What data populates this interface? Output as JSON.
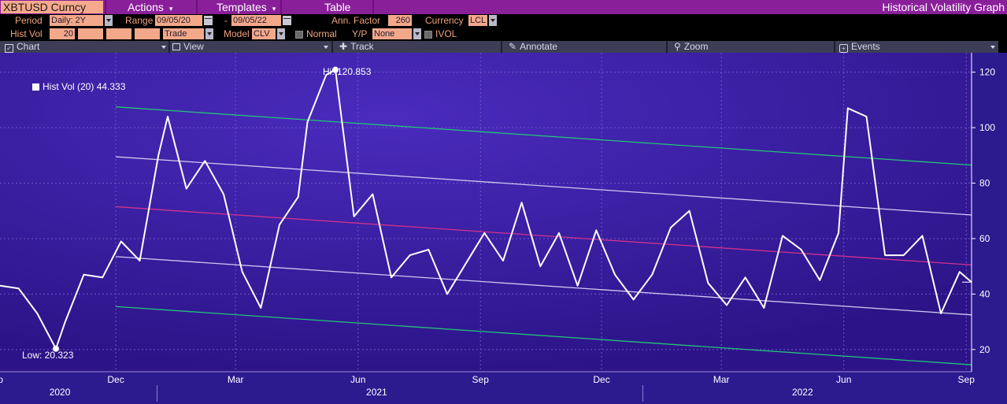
{
  "menubar": {
    "ticker": "XBTUSD Curncy",
    "actions": "Actions",
    "templates": "Templates",
    "table": "Table",
    "app_title": "Historical Volatility Graph"
  },
  "params": {
    "period_label": "Period",
    "period_value": "Daily: 2Y",
    "range_label": "Range",
    "range_start": "09/05/20",
    "range_sep": "-",
    "range_end": "09/05/22",
    "ann_factor_label": "Ann. Factor",
    "ann_factor_value": "260",
    "currency_label": "Currency",
    "currency_value": "LCL",
    "hist_vol_label": "Hist Vol",
    "hist_vol_value": "20",
    "trade_value": "Trade",
    "model_label": "Model",
    "model_value": "CLV",
    "normal_label": "Normal",
    "yp_label": "Y/P",
    "yp_value": "None",
    "ivol_label": "IVOL"
  },
  "toolbar": {
    "chart": "Chart",
    "view": "View",
    "track": "Track",
    "annotate": "Annotate",
    "zoom": "Zoom",
    "events": "Events"
  },
  "annotations": {
    "hi": "Hi: 120.853",
    "low": "Low: 20.323",
    "legend": "Hist Vol (20) 44.333"
  },
  "colors": {
    "menubar": "#8a1f9a",
    "ticker_box": "#f6a98d",
    "plot_bg": "#3a1ca0",
    "series": "#ffffff",
    "channel_outer": "#25c27a",
    "channel_inner": "#cfc8ef",
    "regression": "#d0338c"
  },
  "chart_data": {
    "type": "line",
    "series": [
      {
        "name": "Hist Vol (20)",
        "x": [
          "2020-09-05",
          "2020-09-19",
          "2020-10-03",
          "2020-10-17",
          "2020-10-24",
          "2020-11-07",
          "2020-11-21",
          "2020-12-05",
          "2020-12-19",
          "2021-01-02",
          "2021-01-09",
          "2021-01-23",
          "2021-02-06",
          "2021-02-20",
          "2021-03-06",
          "2021-03-20",
          "2021-04-03",
          "2021-04-17",
          "2021-04-24",
          "2021-05-08",
          "2021-05-15",
          "2021-05-29",
          "2021-06-12",
          "2021-06-26",
          "2021-07-10",
          "2021-07-24",
          "2021-08-07",
          "2021-08-21",
          "2021-09-04",
          "2021-09-18",
          "2021-10-02",
          "2021-10-16",
          "2021-10-30",
          "2021-11-13",
          "2021-11-27",
          "2021-12-11",
          "2021-12-25",
          "2022-01-08",
          "2022-01-22",
          "2022-02-05",
          "2022-02-19",
          "2022-03-05",
          "2022-03-19",
          "2022-04-02",
          "2022-04-16",
          "2022-04-30",
          "2022-05-14",
          "2022-05-28",
          "2022-06-04",
          "2022-06-18",
          "2022-07-02",
          "2022-07-16",
          "2022-07-30",
          "2022-08-13",
          "2022-08-27",
          "2022-09-05"
        ],
        "values": [
          43,
          42,
          33,
          20.3,
          30,
          47,
          46,
          59,
          52,
          90,
          104,
          78,
          88,
          76,
          48,
          35,
          65,
          75,
          102,
          119,
          120.9,
          68,
          76,
          46,
          54,
          56,
          40,
          51,
          62,
          52,
          73,
          50,
          62,
          43,
          63,
          47,
          38,
          47,
          64,
          70,
          44,
          36,
          46,
          35,
          61,
          56,
          45,
          62,
          107,
          104,
          54,
          54,
          61,
          33,
          48,
          44.3
        ]
      }
    ],
    "xlim": [
      "2020-09-05",
      "2022-09-05"
    ],
    "ylim": [
      12,
      127
    ],
    "y_ticks": [
      20,
      40,
      60,
      80,
      100,
      120
    ],
    "x_tick_labels": [
      {
        "date": "2020-09-01",
        "label": "Sep"
      },
      {
        "date": "2020-12-01",
        "label": "Dec"
      },
      {
        "date": "2021-03-01",
        "label": "Mar"
      },
      {
        "date": "2021-06-01",
        "label": "Jun"
      },
      {
        "date": "2021-09-01",
        "label": "Sep"
      },
      {
        "date": "2021-12-01",
        "label": "Dec"
      },
      {
        "date": "2022-03-01",
        "label": "Mar"
      },
      {
        "date": "2022-06-01",
        "label": "Jun"
      },
      {
        "date": "2022-09-01",
        "label": "Sep"
      }
    ],
    "year_labels": [
      {
        "date": "2020-10-20",
        "label": "2020"
      },
      {
        "date": "2021-06-15",
        "label": "2021"
      },
      {
        "date": "2022-05-01",
        "label": "2022"
      }
    ],
    "year_dividers": [
      "2021-01-01",
      "2022-01-01"
    ],
    "channels": [
      {
        "name": "upper-outer",
        "start": {
          "date": "2020-12-01",
          "value": 107.5
        },
        "end": {
          "date": "2022-09-05",
          "value": 86.5
        },
        "color": "#25c27a"
      },
      {
        "name": "upper-inner",
        "start": {
          "date": "2020-12-01",
          "value": 89.5
        },
        "end": {
          "date": "2022-09-05",
          "value": 68.5
        },
        "color": "#cfc8ef"
      },
      {
        "name": "regression",
        "start": {
          "date": "2020-12-01",
          "value": 71.5
        },
        "end": {
          "date": "2022-09-05",
          "value": 50.5
        },
        "color": "#d0338c"
      },
      {
        "name": "lower-inner",
        "start": {
          "date": "2020-12-01",
          "value": 53.5
        },
        "end": {
          "date": "2022-09-05",
          "value": 32.5
        },
        "color": "#cfc8ef"
      },
      {
        "name": "lower-outer",
        "start": {
          "date": "2020-12-01",
          "value": 35.5
        },
        "end": {
          "date": "2022-09-05",
          "value": 14.5
        },
        "color": "#25c27a"
      }
    ],
    "hi_point": {
      "date": "2021-05-15",
      "value": 120.853
    },
    "low_point": {
      "date": "2020-10-17",
      "value": 20.323
    },
    "grid": true,
    "legend_position": "top-left"
  }
}
